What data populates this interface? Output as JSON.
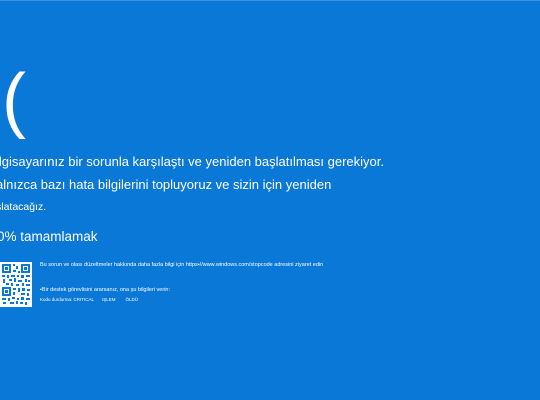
{
  "bsod": {
    "emoticon": "(",
    "message_line1": "ilgisayarınız bir sorunla karşılaştı ve yeniden başlatılması gerekiyor.",
    "message_line2": "alnızca bazı hata bilgilerini topluyoruz ve sizin için yeniden",
    "message_line3": "şlatacağız.",
    "progress_percent": "0%",
    "progress_label": "tamamlamak",
    "more_info": "Bu sorun ve olası düzeltmeler hakkında daha fazla bilgi için https•//www.windows.com/stopcode adresini ziyaret edin",
    "contact_hint": "•Bir destek görevlisini ararsanız, ona şu bilgileri verin:",
    "stop_code_label": "Kodu durdurma: CRITICAL",
    "stop_code_word1": "IŞLEM",
    "stop_code_word2": "ÖLDÜ",
    "qr_icon": "qr-code-icon"
  },
  "colors": {
    "background": "#0a78d7",
    "text": "#ffffff"
  }
}
